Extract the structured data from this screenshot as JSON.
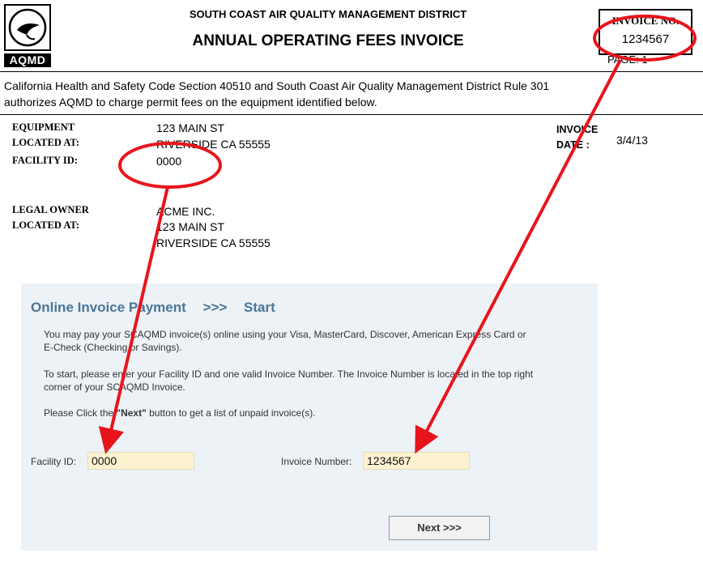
{
  "header": {
    "logo_text": "AQMD",
    "agency": "SOUTH COAST AIR QUALITY MANAGEMENT DISTRICT",
    "title": "ANNUAL OPERATING FEES INVOICE",
    "invoice_no_label": "INVOICE NO.",
    "invoice_no": "1234567",
    "page_label": "PAGE:  1"
  },
  "authorization": {
    "line1": "California Health and Safety Code Section 40510 and South Coast Air Quality Management District Rule 301",
    "line2": "authorizes AQMD to charge permit fees on the equipment identified below."
  },
  "equipment": {
    "label1": "EQUIPMENT",
    "label2": "LOCATED AT:",
    "address1": "123 MAIN ST",
    "address2": "RIVERSIDE CA 55555",
    "facility_label": "FACILITY ID:",
    "facility_id": "0000"
  },
  "invoice_date": {
    "label1": "INVOICE",
    "label2": "DATE :",
    "value": "3/4/13"
  },
  "owner": {
    "label1": "LEGAL OWNER",
    "label2": "LOCATED AT:",
    "name": "ACME INC.",
    "address1": "123  MAIN ST",
    "address2": "RIVERSIDE CA 55555"
  },
  "payment": {
    "title": "Online Invoice Payment",
    "arrow": ">>>",
    "step": "Start",
    "para1_line1": "You may pay your SCAQMD invoice(s) online using your Visa, MasterCard, Discover, American Express Card or",
    "para1_line2": "E-Check (Checking or Savings).",
    "para2_line1": "To start, please enter your Facility ID and one valid Invoice Number. The Invoice Number is located in the top right",
    "para2_line2": "corner of your SCAQMD Invoice.",
    "para3_pre": "Please Click the ",
    "para3_bold": "\"Next\"",
    "para3_post": " button to get a list of unpaid invoice(s).",
    "facility_label": "Facility ID:",
    "facility_value": "0000",
    "invoice_label": "Invoice Number:",
    "invoice_value": "1234567",
    "next_button": "Next >>>"
  },
  "colors": {
    "annotation": "#e8141c",
    "panel_bg": "#edf2f7",
    "title": "#4a7596",
    "input_bg": "#fdf2d0"
  }
}
